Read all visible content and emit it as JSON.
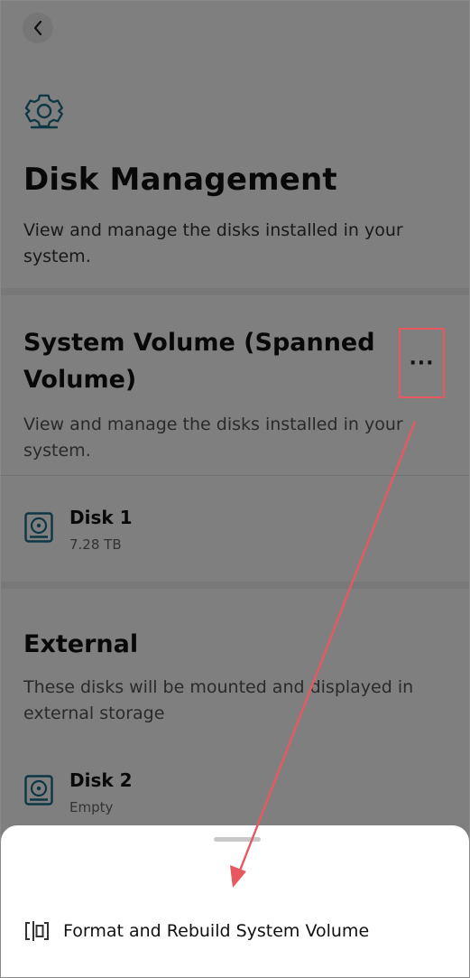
{
  "header": {
    "back_icon": "chevron-left-icon",
    "page_icon": "gear-icon",
    "title": "Disk Management",
    "subtitle": "View and manage the disks installed in your system."
  },
  "system_volume": {
    "title": "System Volume (Spanned Volume)",
    "description": "View and manage the disks installed in your system.",
    "more_label": "···",
    "disks": [
      {
        "name": "Disk 1",
        "detail": "7.28 TB",
        "icon": "hard-disk-icon"
      }
    ]
  },
  "external": {
    "title": "External",
    "description": "These disks will be mounted and displayed in external storage",
    "disks": [
      {
        "name": "Disk 2",
        "detail": "Empty",
        "icon": "hard-disk-icon"
      }
    ]
  },
  "bottom_sheet": {
    "items": [
      {
        "label": "Format and Rebuild System Volume",
        "icon": "rebuild-volume-icon"
      }
    ]
  },
  "annotation": {
    "highlight_color": "#e8585f"
  },
  "colors": {
    "accent": "#1a6f86",
    "overlay": "rgba(0,0,0,0.5)"
  }
}
